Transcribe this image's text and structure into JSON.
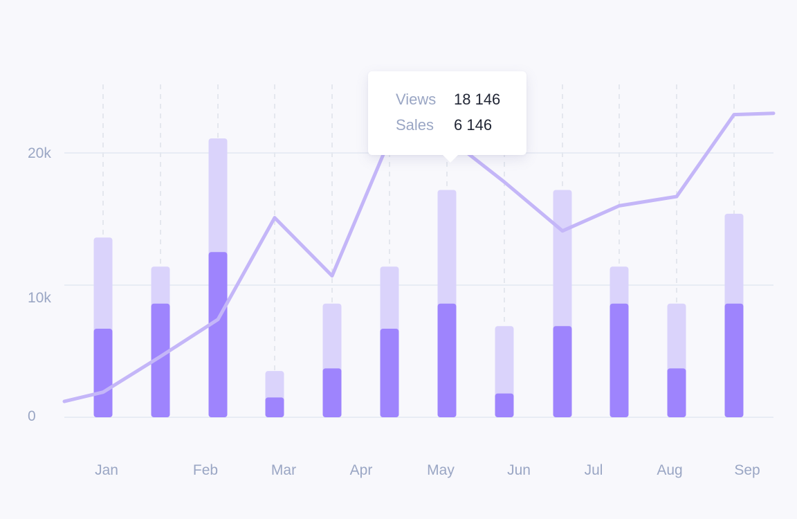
{
  "chart_data": {
    "type": "bar",
    "categories": [
      "Jan",
      "",
      "Feb",
      "Mar",
      "Apr",
      "",
      "May",
      "Jun",
      "",
      "Jul",
      "Aug",
      "Sep"
    ],
    "x_tick_labels": [
      "Jan",
      "Feb",
      "Mar",
      "Apr",
      "May",
      "Jun",
      "Jul",
      "Aug",
      "Sep"
    ],
    "series": [
      {
        "type": "bar",
        "values": [
          6700,
          8600,
          12500,
          1500,
          3700,
          6700,
          8600,
          1800,
          6900,
          8600,
          3700,
          8600
        ]
      },
      {
        "type": "bar",
        "values": [
          13600,
          11400,
          21100,
          3500,
          8600,
          11400,
          17200,
          6900,
          17200,
          11400,
          8600,
          15400
        ]
      },
      {
        "type": "line",
        "values": [
          1900,
          4600,
          7400,
          15100,
          10700,
          21000,
          21200,
          17800,
          14100,
          16000,
          16700,
          22900
        ]
      }
    ],
    "y_tick_labels": [
      "0",
      "10k",
      "20k"
    ],
    "ylim": [
      0,
      25000
    ],
    "grid": true,
    "tooltip": {
      "views_label": "Views",
      "views_value": "18 146",
      "sales_label": "Sales",
      "sales_value": "6 146"
    }
  },
  "colors": {
    "bar_light": "#dad3fb",
    "bar_dark": "#9e84fd",
    "line": "#c4b6f8",
    "grid": "#e3e8f1",
    "dash": "#dde1ea"
  }
}
